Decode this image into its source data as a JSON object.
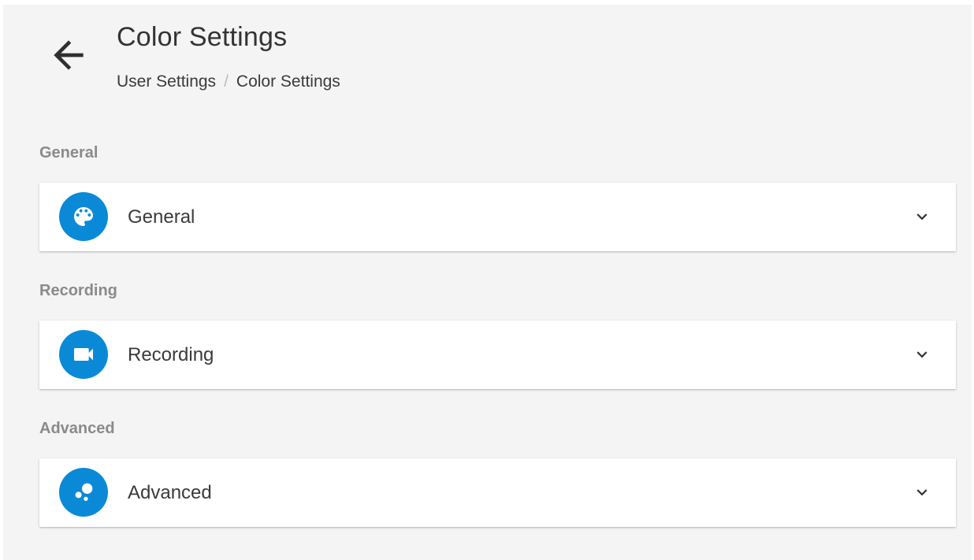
{
  "header": {
    "title": "Color Settings",
    "back_icon": "arrow-back-icon",
    "breadcrumb": {
      "parent": "User Settings",
      "separator": "/",
      "current": "Color Settings"
    }
  },
  "sections": [
    {
      "label": "General",
      "panel_title": "General",
      "icon": "palette-icon",
      "expand_icon": "chevron-down-icon"
    },
    {
      "label": "Recording",
      "panel_title": "Recording",
      "icon": "videocam-icon",
      "expand_icon": "chevron-down-icon"
    },
    {
      "label": "Advanced",
      "panel_title": "Advanced",
      "icon": "bubbles-icon",
      "expand_icon": "chevron-down-icon"
    }
  ],
  "colors": {
    "accent": "#0a8ad6",
    "background": "#f4f4f4",
    "panel": "#ffffff",
    "section_label": "#8a8a8a"
  }
}
